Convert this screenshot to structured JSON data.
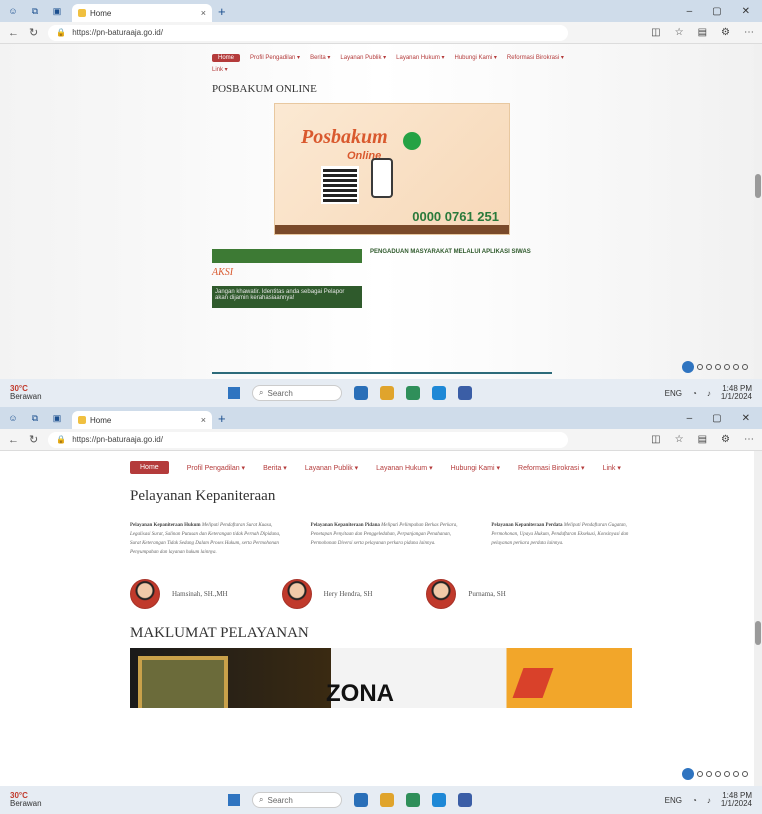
{
  "browser": {
    "tab_title": "Home",
    "url": "https://pn-baturaaja.go.id/",
    "window_controls": [
      "–",
      "▢",
      "✕"
    ]
  },
  "top_page": {
    "menu": [
      "Home",
      "Profil Pengadilan ▾",
      "Berita ▾",
      "Layanan Publik ▾",
      "Layanan Hukum ▾",
      "Hubungi Kami ▾",
      "Reformasi Birokrasi ▾",
      "Link ▾"
    ],
    "section_title": "POSBAKUM ONLINE",
    "banner": {
      "title": "Posbakum",
      "subtitle": "Online",
      "number": "0000 0761 251"
    },
    "aksi_text": "AKSI",
    "sidebar_note": "Jangan khawatir. Identitas anda sebagai Pelapor akan dijamin kerahasiaannya!",
    "right_title": "PENGADUAN MASYARAKAT MELALUI APLIKASI SIWAS"
  },
  "bottom_page": {
    "menu": [
      "Home",
      "Profil Pengadilan ▾",
      "Berita ▾",
      "Layanan Publik ▾",
      "Layanan Hukum ▾",
      "Hubungi Kami ▾",
      "Reformasi Birokrasi ▾",
      "Link ▾"
    ],
    "section_title": "Pelayanan Kepaniteraan",
    "columns": [
      {
        "lead": "Pelayanan Kepaniteraan Hukum",
        "body": "Meliputi Pendaftaran Surat Kuasa, Legalisasi Surat, Salinan Putusan dan Keterangan tidak Pernah Dipidana, Surat Keterangan Tidak Sedang Dalam Proses Hukum, serta Permohonan Penyumpahan dan layanan hukum lainnya."
      },
      {
        "lead": "Pelayanan Kepaniteraan Pidana",
        "body": "Meliputi Pelimpahan Berkas Perkara, Penetapan Penyitaan dan Penggeledahan, Perpanjangan Penahanan, Permohonan Diversi serta pelayanan perkara pidana lainnya."
      },
      {
        "lead": "Pelayanan Kepaniteraan Perdata",
        "body": "Meliputi Pendaftaran Gugatan, Permohonan, Upaya Hukum, Pendaftaran Eksekusi, Konsinyasi dan pelayanan perkara perdata lainnya."
      }
    ],
    "people": [
      "Hamsinah, SH.,MH",
      "Hery Hendra, SH",
      "Purnama, SH"
    ],
    "heading2": "MAKLUMAT PELAYANAN",
    "banner_text": "ZONA"
  },
  "taskbar": {
    "weather_temp": "30°C",
    "weather_desc": "Berawan",
    "search_label": "Search",
    "time": "1:48 PM",
    "date": "1/1/2024",
    "lang": "ENG"
  }
}
